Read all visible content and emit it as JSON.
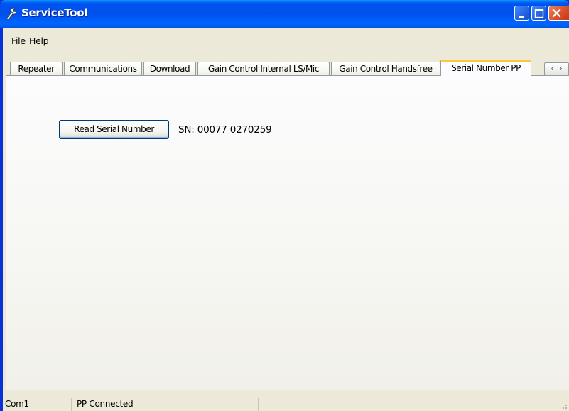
{
  "window": {
    "title": "ServiceTool",
    "title_icon": "wrench-icon",
    "controls": [
      "minimize",
      "maximize",
      "close"
    ],
    "colors": {
      "titlebar": "#0054e3",
      "client": "#ece9d8",
      "active_tab_accent": "#ffc83c",
      "close_button": "#d8512c"
    }
  },
  "menu": {
    "file": "File",
    "help": "Help"
  },
  "tabs": [
    {
      "label": "Repeater",
      "active": false
    },
    {
      "label": "Communications",
      "active": false
    },
    {
      "label": "Download",
      "active": false
    },
    {
      "label": "Gain Control Internal LS/Mic",
      "active": false
    },
    {
      "label": "Gain Control Handsfree",
      "active": false
    },
    {
      "label": "Serial Number PP",
      "active": true
    }
  ],
  "tab_scroll": {
    "left": "‹",
    "right": "›"
  },
  "panel": {
    "read_button_label": "Read Serial Number",
    "serial_text": "SN:  00077 0270259"
  },
  "status": {
    "port": "Com1",
    "connection": "PP Connected",
    "extra": ""
  }
}
